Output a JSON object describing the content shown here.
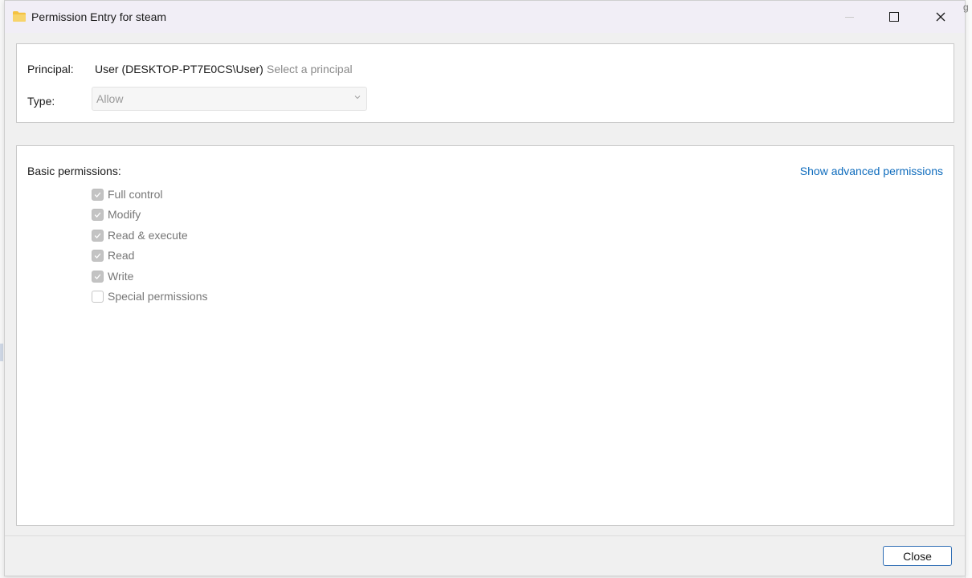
{
  "window": {
    "title": "Permission Entry for steam",
    "icon": "folder-icon"
  },
  "principal": {
    "label": "Principal:",
    "value": "User (DESKTOP-PT7E0CS\\User)",
    "select_link": "Select a principal"
  },
  "type": {
    "label": "Type:",
    "selected": "Allow"
  },
  "permissions": {
    "label": "Basic permissions:",
    "advanced_link": "Show advanced permissions",
    "items": [
      {
        "label": "Full control",
        "checked": true
      },
      {
        "label": "Modify",
        "checked": true
      },
      {
        "label": "Read & execute",
        "checked": true
      },
      {
        "label": "Read",
        "checked": true
      },
      {
        "label": "Write",
        "checked": true
      },
      {
        "label": "Special permissions",
        "checked": false
      }
    ]
  },
  "footer": {
    "close_label": "Close"
  },
  "colors": {
    "link": "#0f6cbd",
    "disabled_text": "#777777",
    "title_bar": "#f1eef6",
    "button_border": "#2e6db4"
  }
}
